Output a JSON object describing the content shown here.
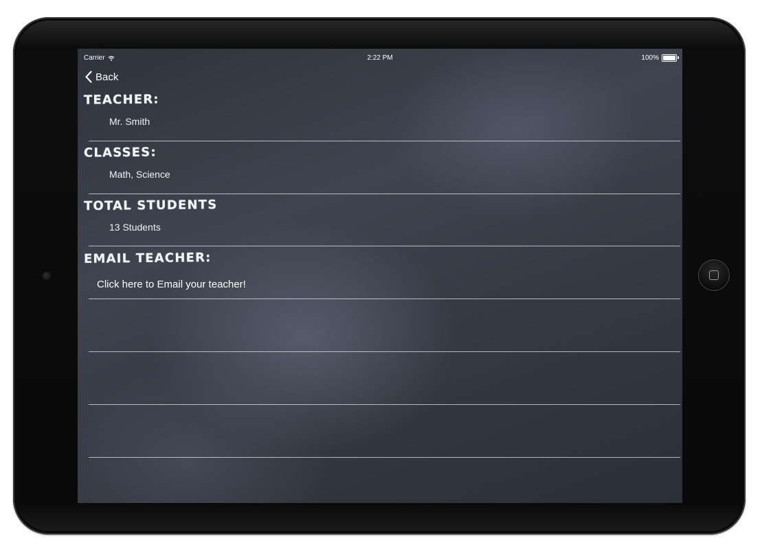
{
  "status_bar": {
    "carrier": "Carrier",
    "time": "2:22 PM",
    "battery": "100%",
    "battery_level": 1.0
  },
  "nav": {
    "back_label": "Back"
  },
  "sections": {
    "teacher": {
      "heading": "TEACHER:",
      "value": "Mr. Smith"
    },
    "classes": {
      "heading": "CLASSES:",
      "value": "Math, Science"
    },
    "students": {
      "heading": "TOTAL STUDENTS",
      "value": "13 Students"
    },
    "email": {
      "heading": "EMAIL TEACHER:",
      "link": "Click here to Email your teacher!"
    }
  },
  "icons": {
    "wifi": "wifi-icon",
    "battery": "battery-icon",
    "back": "chevron-left-icon",
    "home": "home-button-icon"
  },
  "colors": {
    "chalkboard": "#383d48",
    "chalk_text": "#ffffff",
    "rule_line": "#e1e4eb",
    "bezel": "#0a0a0a"
  }
}
